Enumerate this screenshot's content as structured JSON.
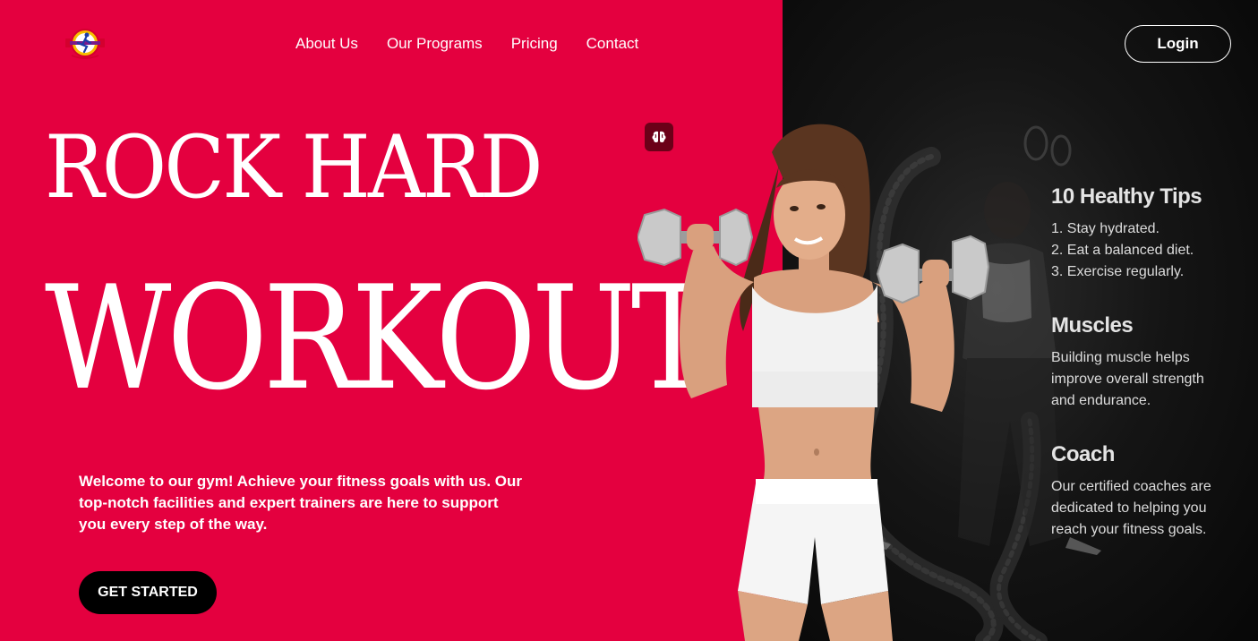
{
  "nav": {
    "items": [
      "About Us",
      "Our Programs",
      "Pricing",
      "Contact"
    ],
    "login_label": "Login"
  },
  "hero": {
    "headline_line1": "ROCK HARD",
    "headline_line2": "WORKOUT",
    "welcome_text": "Welcome to our gym! Achieve your fitness goals with us. Our top-notch facilities and expert trainers are here to support you every step of the way.",
    "cta_label": "GET STARTED"
  },
  "info": {
    "tips": {
      "title": "10 Healthy Tips",
      "items": [
        "1. Stay hydrated.",
        "2. Eat a balanced diet.",
        "3. Exercise regularly."
      ]
    },
    "muscles": {
      "title": "Muscles",
      "text": "Building muscle helps improve overall strength and endurance."
    },
    "coach": {
      "title": "Coach",
      "text": "Our certified coaches are dedicated to helping you reach your fitness goals."
    }
  },
  "colors": {
    "brand_red": "#e4003f",
    "dark_bg": "#0b0b0b",
    "button_black": "#000000",
    "brain_button": "#6b0018"
  },
  "icons": {
    "logo": "gym-runner-logo",
    "brain": "brain-icon"
  }
}
